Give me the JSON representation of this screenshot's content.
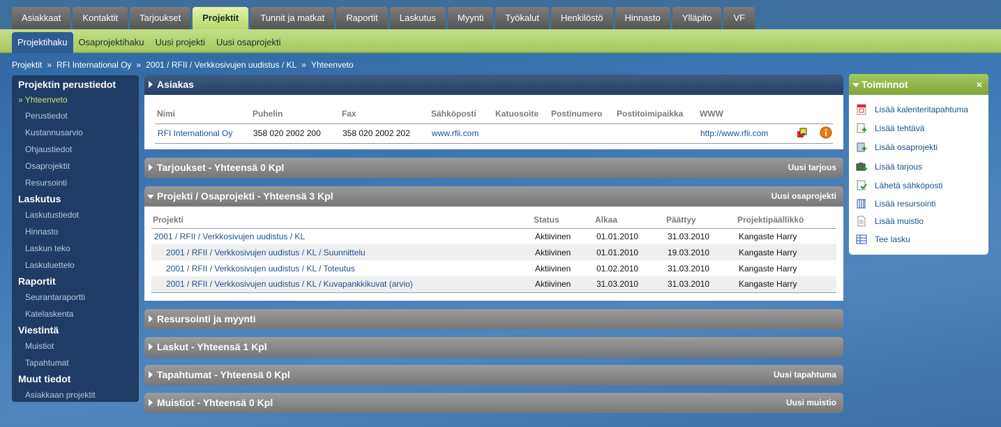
{
  "tabs": [
    "Asiakkaat",
    "Kontaktit",
    "Tarjoukset",
    "Projektit",
    "Tunnit ja matkat",
    "Raportit",
    "Laskutus",
    "Myynti",
    "Työkalut",
    "Henkilöstö",
    "Hinnasto",
    "Ylläpito",
    "VF"
  ],
  "subtabs": [
    "Projektihaku",
    "Osaprojektihaku",
    "Uusi projekti",
    "Uusi osaprojekti"
  ],
  "breadcrumb": [
    "Projektit",
    "RFI International Oy",
    "2001 / RFII / Verkkosivujen uudistus / KL",
    "Yhteenveto"
  ],
  "breadcrumb_sep": "»",
  "sidebar": {
    "sections": [
      {
        "title": "Projektin perustiedot",
        "items": [
          "» Yhteenveto",
          "Perustiedot",
          "Kustannusarvio",
          "Ohjaustiedot",
          "Osaprojektit",
          "Resursointi"
        ]
      },
      {
        "title": "Laskutus",
        "items": [
          "Laskutustiedot",
          "Hinnasto",
          "Laskun teko",
          "Laskuluettelo"
        ]
      },
      {
        "title": "Raportit",
        "items": [
          "Seurantaraportti",
          "Katelaskenta"
        ]
      },
      {
        "title": "Viestintä",
        "items": [
          "Muistiot",
          "Tapahtumat"
        ]
      },
      {
        "title": "Muut tiedot",
        "items": [
          "Asiakkaan projektit"
        ]
      }
    ]
  },
  "asiakas": {
    "title": "Asiakas",
    "headers": [
      "Nimi",
      "Puhelin",
      "Fax",
      "Sähköposti",
      "Katuosoite",
      "Postinumero",
      "Postitoimipaikka",
      "WWW"
    ],
    "row": [
      "RFI International Oy",
      "358 020 2002 200",
      "358 020 2002 202",
      "www.rfii.com",
      "",
      "",
      "",
      "http://www.rfii.com"
    ]
  },
  "tarjoukset": {
    "title": "Tarjoukset - Yhteensä 0 Kpl",
    "action": "Uusi tarjous"
  },
  "projekti": {
    "title": "Projekti / Osaprojekti - Yhteensä 3 Kpl",
    "action": "Uusi osaprojekti",
    "headers": [
      "Projekti",
      "Status",
      "Alkaa",
      "Päättyy",
      "Projektipäällikkö"
    ],
    "rows": [
      [
        "2001 / RFII / Verkkosivujen uudistus / KL",
        "Aktiivinen",
        "01.01.2010",
        "31.03.2010",
        "Kangaste Harry"
      ],
      [
        "2001 / RFII / Verkkosivujen uudistus / KL / Suunnittelu",
        "Aktiivinen",
        "01.01.2010",
        "19.03.2010",
        "Kangaste Harry"
      ],
      [
        "2001 / RFII / Verkkosivujen uudistus / KL / Toteutus",
        "Aktiivinen",
        "01.02.2010",
        "31.03.2010",
        "Kangaste Harry"
      ],
      [
        "2001 / RFII / Verkkosivujen uudistus / KL / Kuvapankkikuvat (arvio)",
        "Aktiivinen",
        "31.03.2010",
        "31.03.2010",
        "Kangaste Harry"
      ]
    ]
  },
  "resursointi": {
    "title": "Resursointi ja myynti"
  },
  "laskut": {
    "title": "Laskut - Yhteensä 1 Kpl"
  },
  "tapahtumat": {
    "title": "Tapahtumat - Yhteensä 0 Kpl",
    "action": "Uusi tapahtuma"
  },
  "muistiot": {
    "title": "Muistiot - Yhteensä 0 Kpl",
    "action": "Uusi muistio"
  },
  "toiminnot": {
    "title": "Toiminnot",
    "close": "×",
    "actions": [
      {
        "label": "Lisää kalenteritapahtuma",
        "icon": "calendar-icon"
      },
      {
        "label": "Lisää tehtävä",
        "icon": "task-add-icon"
      },
      {
        "label": "Lisää osaprojekti",
        "icon": "subproject-add-icon"
      },
      {
        "label": "Lisää tarjous",
        "icon": "offer-add-icon"
      },
      {
        "label": "Lähetä sähköposti",
        "icon": "email-icon"
      },
      {
        "label": "Lisää resursointi",
        "icon": "resource-icon"
      },
      {
        "label": "Lisää muistio",
        "icon": "memo-icon"
      },
      {
        "label": "Tee lasku",
        "icon": "invoice-icon"
      }
    ]
  }
}
